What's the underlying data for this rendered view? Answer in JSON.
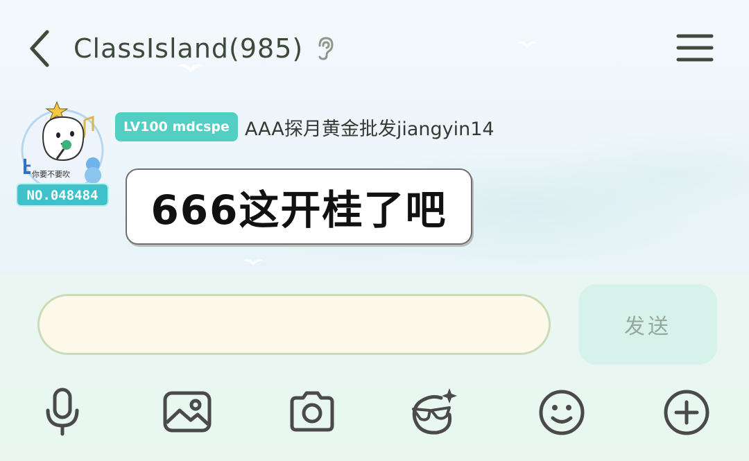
{
  "header": {
    "title": "ClassIsland(985)",
    "back_icon": "chevron-left-icon",
    "ear_icon": "ear-icon",
    "menu_icon": "hamburger-menu-icon"
  },
  "message": {
    "avatar_badge_text": "NO.048484",
    "avatar_caption": "你要不要吹",
    "level_badge": "LV100 mdcspe",
    "sender_name": "AAA探月黄金批发jiangyin14",
    "text": "666这开桂了吧"
  },
  "composer": {
    "input_value": "",
    "input_placeholder": "",
    "send_label": "发送"
  },
  "toolbar": {
    "items": [
      {
        "icon": "microphone-icon"
      },
      {
        "icon": "image-icon"
      },
      {
        "icon": "camera-icon"
      },
      {
        "icon": "glasses-sticker-icon"
      },
      {
        "icon": "emoji-icon"
      },
      {
        "icon": "plus-circle-icon"
      }
    ]
  },
  "colors": {
    "badge_bg": "#52cfc2",
    "send_bg": "#d6f2ea",
    "input_bg": "#fdf9ea",
    "icon_color": "#4a4a4a",
    "title_color": "#3b4a3a"
  }
}
